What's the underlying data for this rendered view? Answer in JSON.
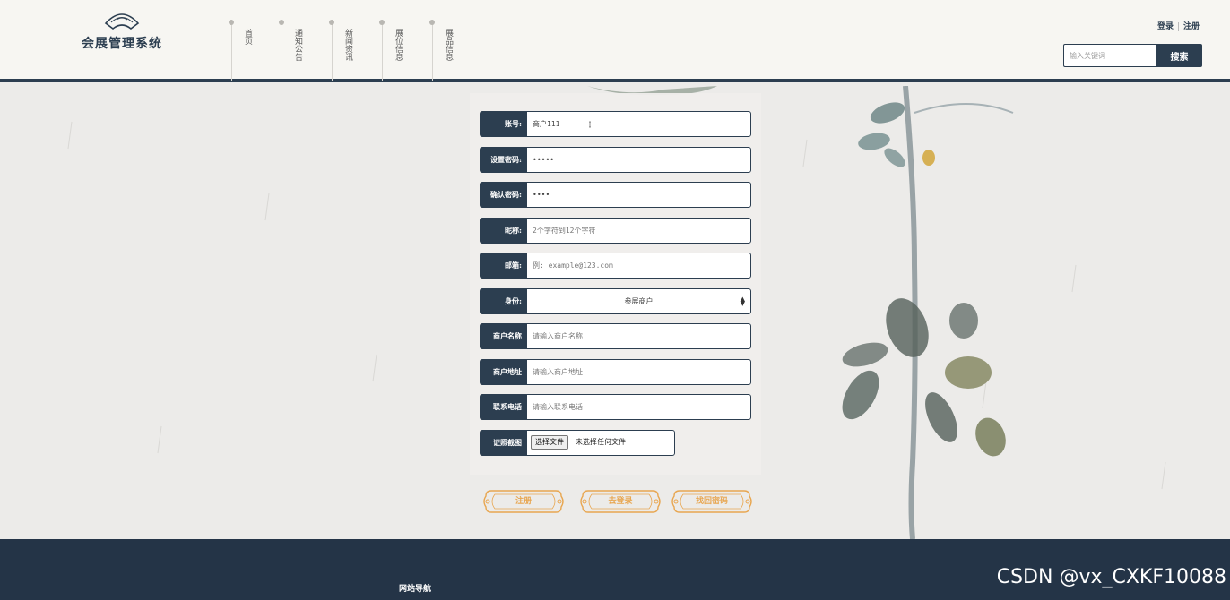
{
  "header": {
    "logo_text": "会展管理系统",
    "nav": [
      {
        "label": "首页"
      },
      {
        "label": "通知公告"
      },
      {
        "label": "新闻资讯"
      },
      {
        "label": "展位信息"
      },
      {
        "label": "展品信息"
      }
    ],
    "login_label": "登录",
    "register_label": "注册",
    "search_placeholder": "输入关键词",
    "search_button": "搜索"
  },
  "form": {
    "account": {
      "label": "账号:",
      "value": "商户111"
    },
    "password": {
      "label": "设置密码:",
      "value": "•••••"
    },
    "confirm_password": {
      "label": "确认密码:",
      "value": "••••"
    },
    "nickname": {
      "label": "昵称:",
      "placeholder": "2个字符到12个字符"
    },
    "email": {
      "label": "邮箱:",
      "placeholder": "例: example@123.com"
    },
    "identity": {
      "label": "身份:",
      "selected": "参展商户"
    },
    "merchant_name": {
      "label": "商户名称",
      "placeholder": "请输入商户名称"
    },
    "merchant_address": {
      "label": "商户地址",
      "placeholder": "请输入商户地址"
    },
    "contact_phone": {
      "label": "联系电话",
      "placeholder": "请输入联系电话"
    },
    "license": {
      "label": "证照截图",
      "button": "选择文件",
      "status": "未选择任何文件"
    }
  },
  "actions": {
    "register": "注册",
    "go_login": "去登录",
    "recover_password": "找回密码"
  },
  "footer": {
    "nav_title": "网站导航",
    "watermark": "CSDN @vx_CXKF10088"
  },
  "colors": {
    "primary": "#2c3e50",
    "footer": "#243447",
    "accent": "#e8a650",
    "page_bg": "#ecebe9"
  }
}
